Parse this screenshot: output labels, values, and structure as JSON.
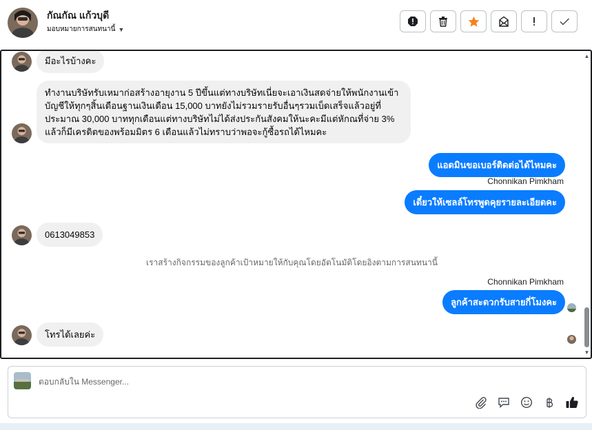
{
  "header": {
    "contact_name": "กัณกัณ แก้วบุดี",
    "assign_label": "มอบหมายการสนทนานี้",
    "actions": [
      {
        "name": "report-button",
        "icon": "alert-octagon-icon"
      },
      {
        "name": "delete-button",
        "icon": "trash-icon"
      },
      {
        "name": "star-button",
        "icon": "star-icon"
      },
      {
        "name": "mark-unread-button",
        "icon": "envelope-icon"
      },
      {
        "name": "important-button",
        "icon": "exclamation-icon"
      },
      {
        "name": "done-button",
        "icon": "check-icon"
      }
    ]
  },
  "messages": {
    "m1": "มีอะไรบ้างคะ",
    "m2": "ทำงานบริษัทรับเหมาก่อสร้างอายุงาน 5 ปีขึ้นแต่ทางบริษัทเนี่ยจะเอาเงินสดจ่ายให้พนักงานเข้าบัญชีให้ทุกๆสิ้นเดือนฐานเงินเดือน 15,000 บาทยังไม่รวมรายรับอื่นๆรวมเบ็ดเสร็จแล้วอยู่ที่ประมาณ 30,000 บาททุกเดือนแต่ทางบริษัทไม่ได้ส่งประกันสังคมให้นะคะมีแต่หักณที่จ่าย 3% แล้วก็มีเครดิตของพร้อมมิตร 6 เดือนแล้วไม่ทราบว่าพอจะกู้ซื้อรถได้ไหมคะ",
    "m3": "แอดมินขอเบอร์ติดต่อได้ไหมคะ",
    "sender1": "Chonnikan Pimkham",
    "m4": "เดี๋ยวให้เซลล์โทรพูดคุยรายละเอียดคะ",
    "m5": "0613049853",
    "system": "เราสร้างกิจกรรมของลูกค้าเป้าหมายให้กับคุณโดยอัตโนมัติโดยอิงตามการสนทนานี้",
    "sender2": "Chonnikan Pimkham",
    "m6": "ลูกค้าสะดวกรับสายกี่โมงคะ",
    "m7": "โทรได้เลยค่ะ"
  },
  "composer": {
    "placeholder": "ตอบกลับใน Messenger...",
    "tools": [
      "paperclip-icon",
      "chat-bubble-icon",
      "smiley-icon",
      "baht-icon",
      "thumbs-up-icon"
    ]
  },
  "colors": {
    "accent": "#0a7cff",
    "star": "#f5821f",
    "incoming_bubble": "#f0f0f0"
  }
}
